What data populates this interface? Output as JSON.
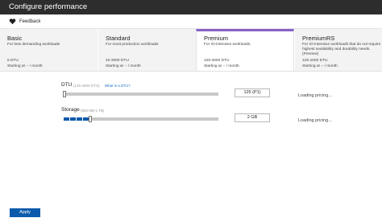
{
  "window": {
    "title": "Configure performance"
  },
  "toolbar": {
    "feedback_label": "Feedback",
    "feedback_icon": "heart-icon"
  },
  "tiers": [
    {
      "name": "Basic",
      "description": "For less demanding workloads",
      "dtu": "5 DTU",
      "price": "Starting at -- / month",
      "selected": false
    },
    {
      "name": "Standard",
      "description": "For most production workloads",
      "dtu": "10-3000 DTU",
      "price": "Starting at -- / month",
      "selected": false
    },
    {
      "name": "Premium",
      "description": "For IO-intensive workloads.",
      "dtu": "125-4000 DTU",
      "price": "Starting at -- / month",
      "selected": true
    },
    {
      "name": "PremiumRS",
      "description": "For IO-intensive workloads that do not require highest availability and durability needs. (Preview)",
      "dtu": "125-1000 DTU",
      "price": "Starting at -- / month",
      "selected": false
    }
  ],
  "dtu": {
    "label": "DTU",
    "range": "(125-4000 DTU)",
    "help_link": "What is a DTU?",
    "value": "125 (P1)",
    "level": 0.0,
    "pricing": "Loading pricing..."
  },
  "storage": {
    "label": "Storage",
    "range": "(500 MB-1 TB)",
    "value": "2 GB",
    "level": 0.16,
    "pricing": "Loading pricing..."
  },
  "actions": {
    "apply_label": "Apply"
  },
  "colors": {
    "accent": "#8661c5",
    "primary_button": "#0b5aab",
    "slider_fill": "#0b5aab"
  }
}
